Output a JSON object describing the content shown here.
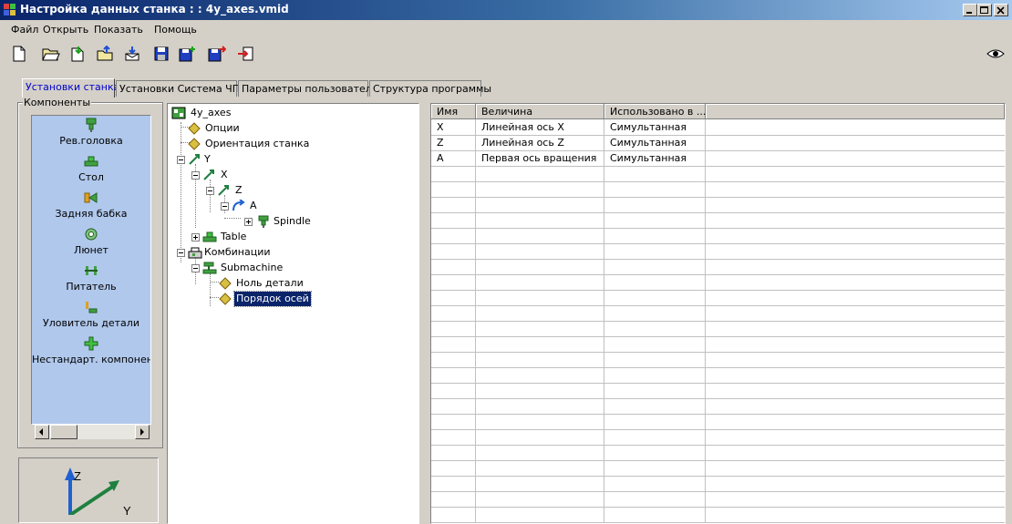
{
  "window": {
    "title": "Настройка данных станка : : 4y_axes.vmid"
  },
  "menu": [
    "Файл",
    "Открыть",
    "Показать",
    "Помощь"
  ],
  "toolbar": {
    "icons": [
      "new-file-icon",
      "open-folder-icon",
      "import-icon",
      "open-upload-icon",
      "export-icon",
      "save-icon",
      "save-add-icon",
      "save-as-icon",
      "exit-icon"
    ],
    "right_icon": "eye-icon"
  },
  "tabs": [
    "Установки станка",
    "Установки Система ЧПУ",
    "Параметры пользователя",
    "Структура программы"
  ],
  "components": {
    "legend": "Компоненты",
    "items": [
      {
        "label": "Рев.головка",
        "icon": "turret-icon"
      },
      {
        "label": "Стол",
        "icon": "table-icon"
      },
      {
        "label": "Задняя бабка",
        "icon": "tailstock-icon"
      },
      {
        "label": "Люнет",
        "icon": "steady-rest-icon"
      },
      {
        "label": "Питатель",
        "icon": "feeder-icon"
      },
      {
        "label": "Уловитель детали",
        "icon": "part-catcher-icon"
      },
      {
        "label": "Нестандарт. компонент",
        "icon": "custom-component-icon"
      }
    ]
  },
  "axis_widget": {
    "z": "Z",
    "y": "Y"
  },
  "tree": [
    {
      "label": "4y_axes"
    },
    {
      "label": "Опции"
    },
    {
      "label": "Ориентация станка"
    },
    {
      "label": "Y"
    },
    {
      "label": "X"
    },
    {
      "label": "Z"
    },
    {
      "label": "A"
    },
    {
      "label": "Spindle"
    },
    {
      "label": "Table"
    },
    {
      "label": "Комбинации"
    },
    {
      "label": "Submachine"
    },
    {
      "label": "Ноль детали"
    },
    {
      "label": "Порядок осей"
    }
  ],
  "grid": {
    "columns": [
      "Имя",
      "Величина",
      "Использовано в ..."
    ],
    "rows": [
      [
        "X",
        "Линейная ось X",
        "Симультанная"
      ],
      [
        "Z",
        "Линейная ось Z",
        "Симультанная"
      ],
      [
        "A",
        "Первая ось вращения",
        "Симультанная"
      ]
    ]
  },
  "colors": {
    "title_gradient_start": "#0a246a",
    "component_list_bg": "#b0c8ec",
    "selection": "#0a246a",
    "active_tab_text": "#0000cc"
  }
}
